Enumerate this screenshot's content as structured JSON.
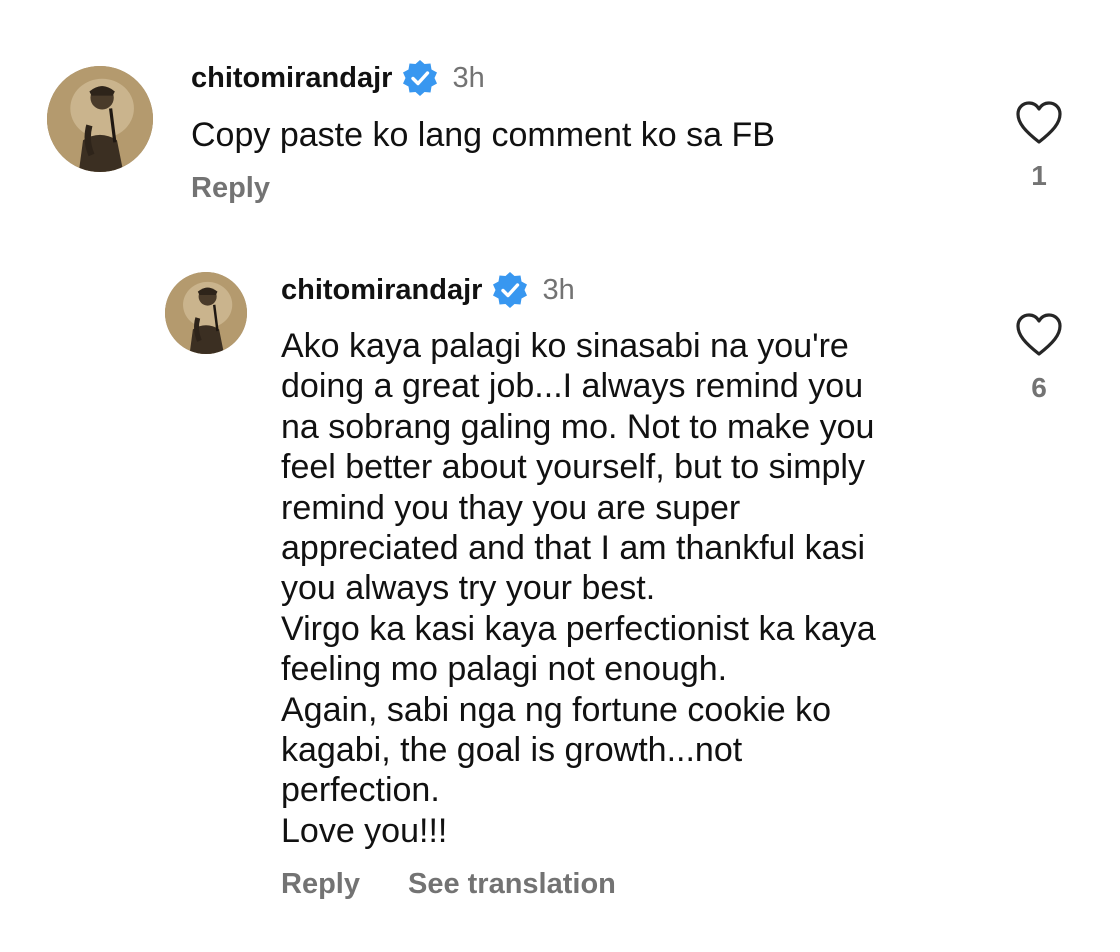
{
  "comment": {
    "username": "chitomirandajr",
    "verified_icon": "verified-badge-icon",
    "time": "3h",
    "text": "Copy paste ko lang comment ko sa  FB",
    "reply_label": "Reply",
    "like_count": "1",
    "avatar_icon": "profile-photo"
  },
  "reply": {
    "username": "chitomirandajr",
    "verified_icon": "verified-badge-icon",
    "time": "3h",
    "lines": [
      "Ako kaya palagi ko sinasabi na you're",
      "doing a great job...I always remind you",
      "na sobrang galing mo. Not to make you",
      "feel better about yourself, but to simply",
      "remind you thay you are super",
      "appreciated and that I am thankful kasi",
      "you always try your best.",
      "Virgo ka kasi kaya perfectionist ka kaya",
      "feeling mo palagi not enough.",
      "Again, sabi nga ng fortune cookie ko",
      "kagabi, the goal is growth...not",
      "perfection.",
      "Love you!!!"
    ],
    "reply_label": "Reply",
    "see_translation_label": "See translation",
    "like_count": "6",
    "avatar_icon": "profile-photo"
  },
  "colors": {
    "text": "#111111",
    "secondary": "#737373",
    "verified": "#3897f0",
    "heart_outline": "#262626"
  }
}
